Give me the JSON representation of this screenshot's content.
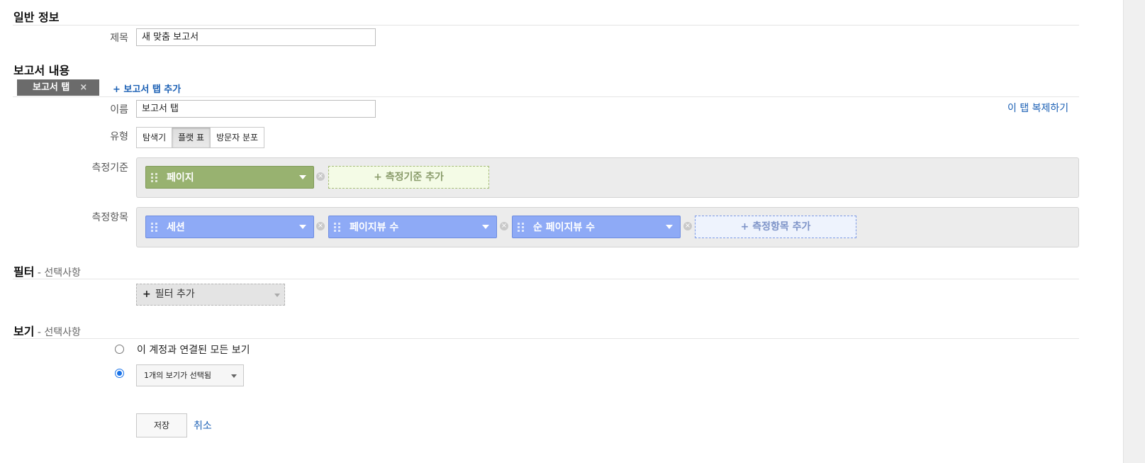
{
  "general": {
    "title": "일반 정보",
    "title_label": "제목",
    "title_value": "새 맞춤 보고서"
  },
  "content": {
    "title": "보고서 내용",
    "tab_label": "보고서 탭",
    "tab_close": "×",
    "add_tab": "+ 보고서 탭 추가",
    "name_label": "이름",
    "name_value": "보고서 탭",
    "duplicate_tab": "이 탭 복제하기",
    "type_label": "유형",
    "types": [
      "탐색기",
      "플랫 표",
      "방문자 분포"
    ],
    "selected_type": "플랫 표",
    "dimensions_label": "측정기준",
    "dimensions": [
      "페이지"
    ],
    "add_dimension": "+ 측정기준 추가",
    "metrics_label": "측정항목",
    "metrics": [
      "세션",
      "페이지뷰 수",
      "순 페이지뷰 수"
    ],
    "add_metric": "+ 측정항목 추가"
  },
  "filters": {
    "title": "필터",
    "optional": " - 선택사항",
    "add_plus": "+",
    "add_label": "필터 추가"
  },
  "views": {
    "title": "보기",
    "optional": " - 선택사항",
    "all_views": "이 계정과 연결된 모든 보기",
    "selected_views": "1개의 보기가 선택됨"
  },
  "actions": {
    "save": "저장",
    "cancel": "취소"
  },
  "colors": {
    "dimension_chip": "#98b270",
    "metric_chip": "#8eaaf6",
    "link": "#1a5fb4"
  }
}
